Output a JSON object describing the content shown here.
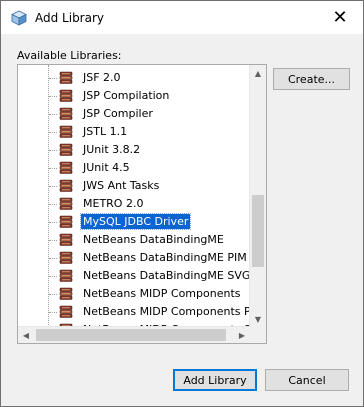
{
  "window": {
    "title": "Add Library",
    "close_glyph": "✕"
  },
  "available_libraries_label": "Available Libraries:",
  "libraries": [
    {
      "label": "JSF 2.0",
      "selected": false
    },
    {
      "label": "JSP Compilation",
      "selected": false
    },
    {
      "label": "JSP Compiler",
      "selected": false
    },
    {
      "label": "JSTL 1.1",
      "selected": false
    },
    {
      "label": "JUnit 3.8.2",
      "selected": false
    },
    {
      "label": "JUnit 4.5",
      "selected": false
    },
    {
      "label": "JWS Ant Tasks",
      "selected": false
    },
    {
      "label": "METRO 2.0",
      "selected": false
    },
    {
      "label": "MySQL JDBC Driver",
      "selected": true
    },
    {
      "label": "NetBeans DataBindingME",
      "selected": false
    },
    {
      "label": "NetBeans DataBindingME PIM",
      "selected": false
    },
    {
      "label": "NetBeans DataBindingME SVG",
      "selected": false
    },
    {
      "label": "NetBeans MIDP Components",
      "selected": false
    },
    {
      "label": "NetBeans MIDP Components PDA",
      "selected": false
    },
    {
      "label": "NetBeans MIDP Components SVG",
      "selected": false
    }
  ],
  "buttons": {
    "create": "Create...",
    "add_library": "Add Library",
    "cancel": "Cancel"
  },
  "colors": {
    "selection": "#0a64d2",
    "default_button_border": "#0078d7",
    "library_icon": "#8b3a2a"
  },
  "scrollbars": {
    "vertical_arrow_up": "▲",
    "vertical_arrow_down": "▼",
    "horizontal_arrow_left": "◀",
    "horizontal_arrow_right": "▶"
  }
}
